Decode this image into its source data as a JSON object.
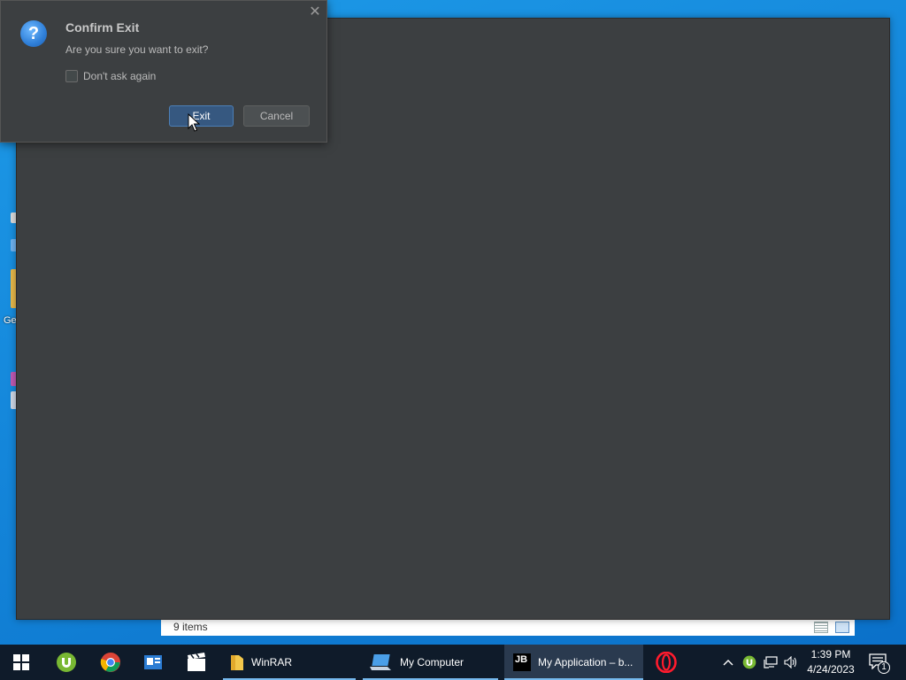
{
  "desktop": {
    "partial_label": "Ge"
  },
  "dialog": {
    "title": "Confirm Exit",
    "message": "Are you sure you want to exit?",
    "icon": "question-icon",
    "checkbox_label": "Don't ask again",
    "checkbox_checked": false,
    "exit_label": "Exit",
    "cancel_label": "Cancel"
  },
  "explorer_status": {
    "item_count": "9 items"
  },
  "taskbar": {
    "pinned": [
      {
        "name": "start-icon"
      },
      {
        "name": "utorrent-icon"
      },
      {
        "name": "chrome-icon"
      },
      {
        "name": "news-app-icon"
      },
      {
        "name": "video-editor-icon"
      }
    ],
    "windows": [
      {
        "label": "WinRAR",
        "icon": "folder-icon"
      },
      {
        "label": "My Computer",
        "icon": "computer-icon"
      },
      {
        "label": "My Application – b...",
        "icon": "jetbrains-icon",
        "icon_text": "JB"
      }
    ],
    "opera_icon": "opera-icon",
    "tray": {
      "time": "1:39 PM",
      "date": "4/24/2023",
      "notification_count": "1"
    }
  },
  "colors": {
    "dialog_bg": "#3c3f41",
    "primary_button": "#365880",
    "taskbar_bg": "#0f1b2a",
    "desktop_blue": "#1486da"
  }
}
